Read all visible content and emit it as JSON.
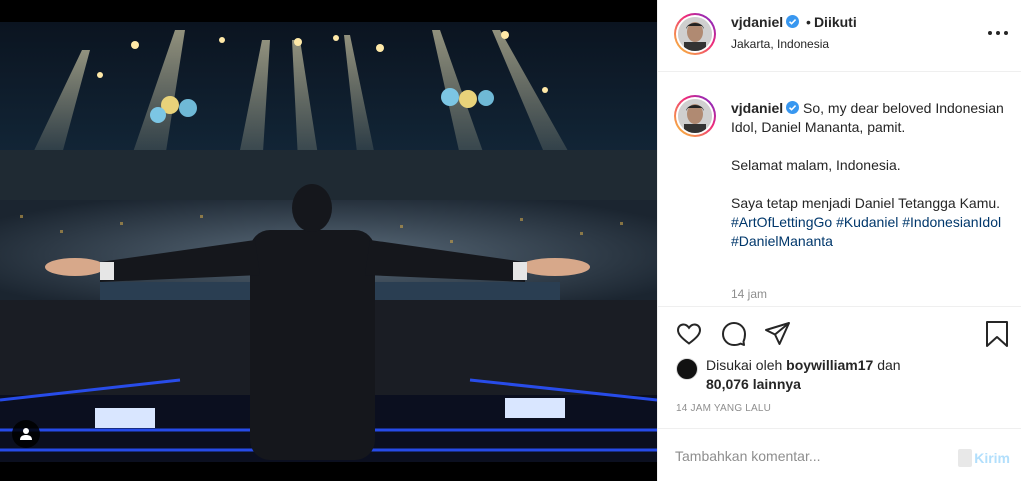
{
  "post": {
    "username": "vjdaniel",
    "follow_status": "Diikuti",
    "location": "Jakarta, Indonesia",
    "more_icon": "more-dots-icon",
    "verified_icon": "verified-badge-icon"
  },
  "caption": {
    "username": "vjdaniel",
    "line1": "So, my dear beloved Indonesian Idol, Daniel Mananta, pamit.",
    "line2": "Selamat malam, Indonesia.",
    "line3": "Saya tetap menjadi Daniel Tetangga Kamu.",
    "hashtags": [
      "#ArtOfLettingGo",
      "#Kudaniel",
      "#IndonesianIdol",
      "#DanielMananta"
    ],
    "time": "14 jam"
  },
  "actions": {
    "like_icon": "heart-icon",
    "comment_icon": "comment-icon",
    "share_icon": "share-icon",
    "save_icon": "bookmark-icon"
  },
  "likes": {
    "prefix": "Disukai oleh",
    "liker": "boywilliam17",
    "connector": "dan",
    "count": "80,076 lainnya"
  },
  "time_ago": "14 JAM YANG LALU",
  "comment": {
    "placeholder": "Tambahkan komentar...",
    "post_label": "Kirim"
  },
  "photo": {
    "tag_icon": "user-tag-icon"
  },
  "colors": {
    "verified": "#3897f0",
    "hashtag": "#00376b",
    "post_disabled": "#b2dffc",
    "muted": "#8e8e8e"
  }
}
